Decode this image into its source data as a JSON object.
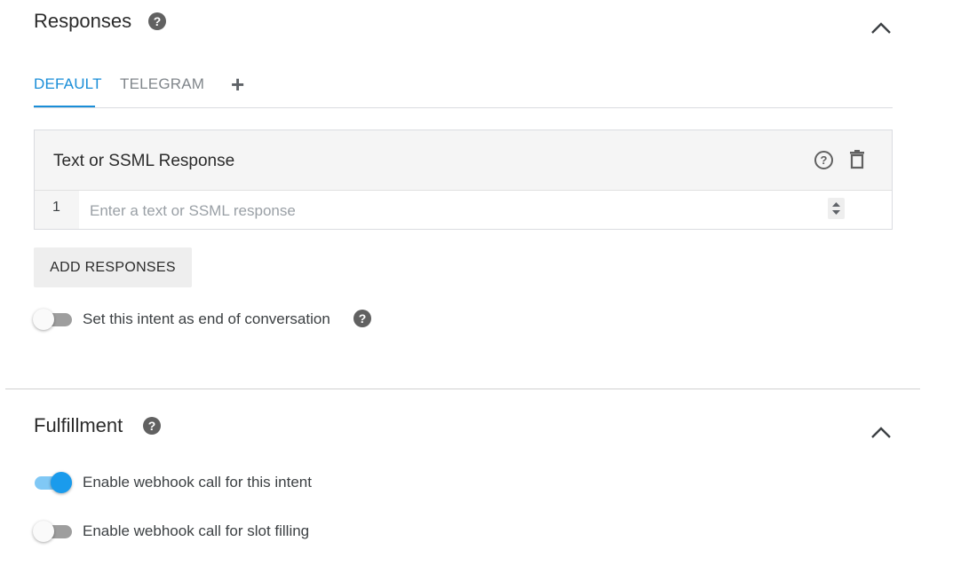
{
  "responses": {
    "title": "Responses",
    "tabs": [
      {
        "label": "DEFAULT",
        "active": true
      },
      {
        "label": "TELEGRAM",
        "active": false
      }
    ],
    "add_tab_symbol": "+",
    "card": {
      "title": "Text or SSML Response",
      "row_number": "1",
      "placeholder": "Enter a text or SSML response",
      "value": ""
    },
    "add_button_label": "ADD RESPONSES",
    "end_conversation": {
      "label": "Set this intent as end of conversation",
      "enabled": false
    }
  },
  "fulfillment": {
    "title": "Fulfillment",
    "webhook_intent": {
      "label": "Enable webhook call for this intent",
      "enabled": true
    },
    "webhook_slot": {
      "label": "Enable webhook call for slot filling",
      "enabled": false
    }
  },
  "icons": {
    "help": "help-circle-icon",
    "help_outline": "help-outline-icon",
    "delete": "trash-icon",
    "collapse": "chevron-up-icon"
  },
  "colors": {
    "accent": "#1a8ed8",
    "toggle_on": "#1a9bec",
    "toggle_off": "#9e9e9e"
  }
}
